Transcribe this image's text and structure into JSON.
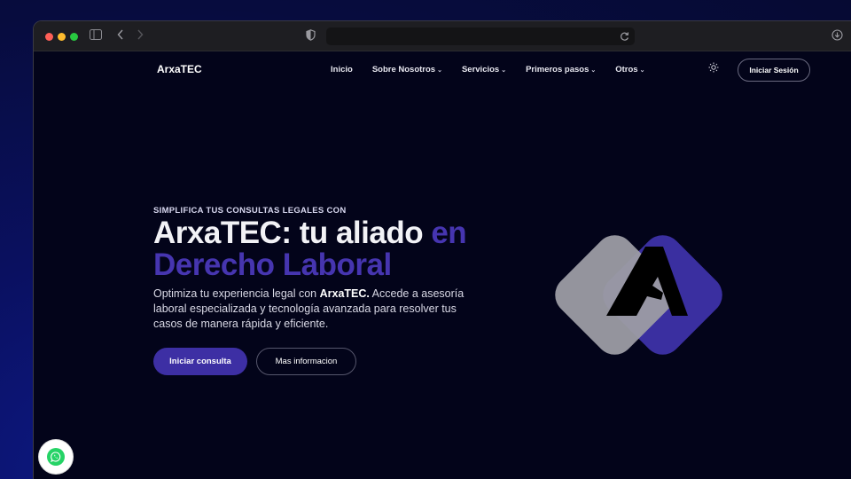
{
  "nav": {
    "brand": "ArxaTEC",
    "items": [
      {
        "label": "Inicio",
        "has_dropdown": false
      },
      {
        "label": "Sobre Nosotros",
        "has_dropdown": true
      },
      {
        "label": "Servicios",
        "has_dropdown": true
      },
      {
        "label": "Primeros pasos",
        "has_dropdown": true
      },
      {
        "label": "Otros",
        "has_dropdown": true
      }
    ],
    "theme_icon": "sun-icon",
    "login_label": "Iniciar Sesión"
  },
  "hero": {
    "eyebrow": "SIMPLIFICA TUS CONSULTAS LEGALES CON",
    "title_white": "ArxaTEC: tu aliado ",
    "title_purple_1": "en",
    "title_purple_2": "Derecho Laboral",
    "lead_pre": "Optimiza tu experiencia legal con ",
    "lead_bold": "ArxaTEC.",
    "lead_post": " Accede a asesoría laboral especializada y tecnología avanzada para resolver tus casos de manera rápida y eficiente.",
    "primary_cta": "Iniciar consulta",
    "secondary_cta": "Mas informacion"
  },
  "colors": {
    "accent": "#3d2fa4",
    "accent_text": "#4635b0",
    "page_bg": "#03041a"
  },
  "floating": {
    "whatsapp_icon": "whatsapp-icon"
  }
}
